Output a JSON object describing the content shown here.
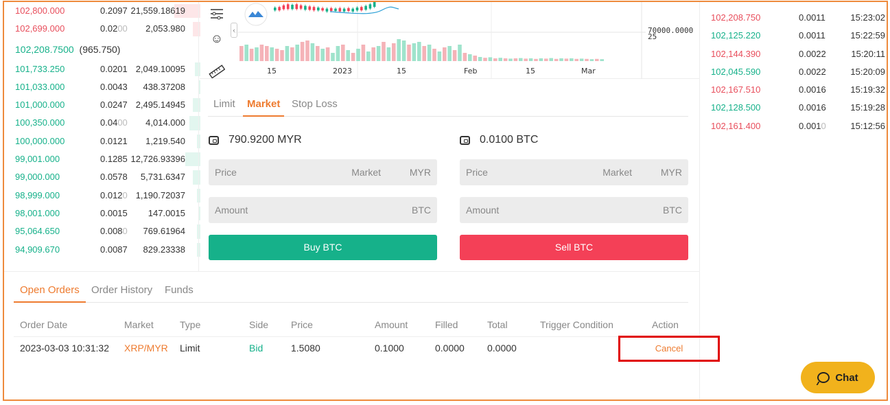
{
  "orderbook": {
    "asks": [
      {
        "price": "102,800.000",
        "qty": "0.2097",
        "total": "21,559.18619",
        "fill": 0.14
      },
      {
        "price": "102,699.000",
        "qty_main": "0.02",
        "qty_tail": "00",
        "total": "2,053.980",
        "fill": 0.04
      }
    ],
    "mid": {
      "price": "102,208.7500",
      "change": "(965.750)"
    },
    "bids": [
      {
        "price": "101,733.250",
        "qty": "0.0201",
        "total": "2,049.10095",
        "fill": 0.03
      },
      {
        "price": "101,033.000",
        "qty": "0.0043",
        "total": "438.37208",
        "fill": 0.01
      },
      {
        "price": "101,000.000",
        "qty": "0.0247",
        "total": "2,495.14945",
        "fill": 0.04
      },
      {
        "price": "100,350.000",
        "qty_main": "0.04",
        "qty_tail": "00",
        "total": "4,014.000",
        "fill": 0.06
      },
      {
        "price": "100,000.000",
        "qty": "0.0121",
        "total": "1,219.540",
        "fill": 0.02
      },
      {
        "price": "99,001.000",
        "qty": "0.1285",
        "total": "12,726.93396",
        "fill": 0.08
      },
      {
        "price": "99,000.000",
        "qty": "0.0578",
        "total": "5,731.6347",
        "fill": 0.04
      },
      {
        "price": "98,999.000",
        "qty_main": "0.012",
        "qty_tail": "0",
        "total": "1,190.72037",
        "fill": 0.02
      },
      {
        "price": "98,001.000",
        "qty": "0.0015",
        "total": "147.0015",
        "fill": 0.01
      },
      {
        "price": "95,064.650",
        "qty_main": "0.008",
        "qty_tail": "0",
        "total": "769.61964",
        "fill": 0.02
      },
      {
        "price": "94,909.670",
        "qty": "0.0087",
        "total": "829.23338",
        "fill": 0.02
      }
    ]
  },
  "chart": {
    "price_tag": "70000.0000",
    "price_tag_sub": "25",
    "x_labels": [
      "15",
      "2023",
      "15",
      "Feb",
      "15",
      "Mar"
    ],
    "volumes": [
      {
        "v": 0.55,
        "c": "r"
      },
      {
        "v": 0.6,
        "c": "g"
      },
      {
        "v": 0.45,
        "c": "r"
      },
      {
        "v": 0.5,
        "c": "g"
      },
      {
        "v": 0.6,
        "c": "r"
      },
      {
        "v": 0.55,
        "c": "r"
      },
      {
        "v": 0.5,
        "c": "g"
      },
      {
        "v": 0.45,
        "c": "r"
      },
      {
        "v": 0.4,
        "c": "r"
      },
      {
        "v": 0.55,
        "c": "g"
      },
      {
        "v": 0.5,
        "c": "r"
      },
      {
        "v": 0.6,
        "c": "g"
      },
      {
        "v": 0.7,
        "c": "r"
      },
      {
        "v": 0.75,
        "c": "r"
      },
      {
        "v": 0.65,
        "c": "g"
      },
      {
        "v": 0.55,
        "c": "r"
      },
      {
        "v": 0.45,
        "c": "g"
      },
      {
        "v": 0.5,
        "c": "r"
      },
      {
        "v": 0.3,
        "c": "g"
      },
      {
        "v": 0.55,
        "c": "g"
      },
      {
        "v": 0.6,
        "c": "r"
      },
      {
        "v": 0.4,
        "c": "g"
      },
      {
        "v": 0.3,
        "c": "r"
      },
      {
        "v": 0.45,
        "c": "g"
      },
      {
        "v": 0.6,
        "c": "r"
      },
      {
        "v": 0.35,
        "c": "g"
      },
      {
        "v": 0.5,
        "c": "r"
      },
      {
        "v": 0.55,
        "c": "g"
      },
      {
        "v": 0.7,
        "c": "r"
      },
      {
        "v": 0.5,
        "c": "g"
      },
      {
        "v": 0.65,
        "c": "r"
      },
      {
        "v": 0.8,
        "c": "g"
      },
      {
        "v": 0.75,
        "c": "g"
      },
      {
        "v": 0.6,
        "c": "r"
      },
      {
        "v": 0.65,
        "c": "g"
      },
      {
        "v": 0.7,
        "c": "g"
      },
      {
        "v": 0.55,
        "c": "r"
      },
      {
        "v": 0.6,
        "c": "g"
      },
      {
        "v": 0.45,
        "c": "r"
      },
      {
        "v": 0.35,
        "c": "g"
      },
      {
        "v": 0.5,
        "c": "r"
      },
      {
        "v": 0.55,
        "c": "g"
      },
      {
        "v": 0.4,
        "c": "r"
      },
      {
        "v": 0.6,
        "c": "g"
      },
      {
        "v": 0.3,
        "c": "r"
      },
      {
        "v": 0.25,
        "c": "g"
      },
      {
        "v": 0.2,
        "c": "r"
      },
      {
        "v": 0.15,
        "c": "g"
      },
      {
        "v": 0.12,
        "c": "r"
      },
      {
        "v": 0.14,
        "c": "g"
      },
      {
        "v": 0.1,
        "c": "r"
      },
      {
        "v": 0.12,
        "c": "g"
      },
      {
        "v": 0.1,
        "c": "r"
      },
      {
        "v": 0.09,
        "c": "g"
      },
      {
        "v": 0.1,
        "c": "r"
      },
      {
        "v": 0.11,
        "c": "g"
      },
      {
        "v": 0.09,
        "c": "r"
      },
      {
        "v": 0.1,
        "c": "g"
      },
      {
        "v": 0.08,
        "c": "r"
      },
      {
        "v": 0.1,
        "c": "g"
      },
      {
        "v": 0.09,
        "c": "r"
      },
      {
        "v": 0.11,
        "c": "g"
      },
      {
        "v": 0.08,
        "c": "r"
      },
      {
        "v": 0.1,
        "c": "g"
      },
      {
        "v": 0.09,
        "c": "r"
      },
      {
        "v": 0.1,
        "c": "g"
      },
      {
        "v": 0.08,
        "c": "r"
      },
      {
        "v": 0.09,
        "c": "g"
      },
      {
        "v": 0.08,
        "c": "r"
      },
      {
        "v": 0.07,
        "c": "g"
      },
      {
        "v": 0.08,
        "c": "r"
      },
      {
        "v": 0.07,
        "c": "g"
      }
    ],
    "candles": [
      {
        "y": 0.5,
        "h": 0.3,
        "c": "g"
      },
      {
        "y": 0.45,
        "h": 0.35,
        "c": "r"
      },
      {
        "y": 0.3,
        "h": 0.4,
        "c": "r"
      },
      {
        "y": 0.2,
        "h": 0.5,
        "c": "r"
      },
      {
        "y": 0.25,
        "h": 0.45,
        "c": "g"
      },
      {
        "y": 0.2,
        "h": 0.5,
        "c": "r"
      },
      {
        "y": 0.3,
        "h": 0.35,
        "c": "r"
      },
      {
        "y": 0.35,
        "h": 0.4,
        "c": "g"
      },
      {
        "y": 0.4,
        "h": 0.35,
        "c": "r"
      },
      {
        "y": 0.45,
        "h": 0.35,
        "c": "r"
      },
      {
        "y": 0.5,
        "h": 0.3,
        "c": "g"
      },
      {
        "y": 0.55,
        "h": 0.25,
        "c": "r"
      },
      {
        "y": 0.6,
        "h": 0.3,
        "c": "g"
      },
      {
        "y": 0.55,
        "h": 0.3,
        "c": "r"
      },
      {
        "y": 0.6,
        "h": 0.25,
        "c": "g"
      },
      {
        "y": 0.55,
        "h": 0.35,
        "c": "r"
      },
      {
        "y": 0.6,
        "h": 0.3,
        "c": "g"
      },
      {
        "y": 0.55,
        "h": 0.3,
        "c": "r"
      },
      {
        "y": 0.6,
        "h": 0.3,
        "c": "g"
      },
      {
        "y": 0.5,
        "h": 0.3,
        "c": "g"
      },
      {
        "y": 0.45,
        "h": 0.35,
        "c": "r"
      },
      {
        "y": 0.35,
        "h": 0.4,
        "c": "g"
      },
      {
        "y": 0.2,
        "h": 0.45,
        "c": "g"
      },
      {
        "y": 0.0,
        "h": 0.5,
        "c": "g"
      }
    ]
  },
  "trade": {
    "tabs": [
      "Limit",
      "Market",
      "Stop Loss"
    ],
    "active_tab": 1,
    "buy": {
      "balance": "790.9200 MYR",
      "price_label": "Price",
      "price_hint": "Market",
      "price_unit": "MYR",
      "amount_label": "Amount",
      "amount_unit": "BTC",
      "button": "Buy BTC"
    },
    "sell": {
      "balance": "0.0100 BTC",
      "price_label": "Price",
      "price_hint": "Market",
      "price_unit": "MYR",
      "amount_label": "Amount",
      "amount_unit": "BTC",
      "button": "Sell BTC"
    }
  },
  "orders": {
    "tabs": [
      "Open Orders",
      "Order History",
      "Funds"
    ],
    "headers": [
      "Order Date",
      "Market",
      "Type",
      "Side",
      "Price",
      "Amount",
      "Filled",
      "Total",
      "Trigger Condition",
      "Action"
    ],
    "row": {
      "date": "2023-03-03 10:31:32",
      "market": "XRP/MYR",
      "type": "Limit",
      "side": "Bid",
      "price": "1.5080",
      "amount": "0.1000",
      "filled": "0.0000",
      "total": "0.0000",
      "trigger": "",
      "action": "Cancel"
    }
  },
  "trades": [
    {
      "price": "102,208.750",
      "qty": "0.0011",
      "time": "15:23:02",
      "side": "sell"
    },
    {
      "price": "102,125.220",
      "qty": "0.0011",
      "time": "15:22:59",
      "side": "buy"
    },
    {
      "price": "102,144.390",
      "qty": "0.0022",
      "time": "15:20:11",
      "side": "sell"
    },
    {
      "price": "102,045.590",
      "qty": "0.0022",
      "time": "15:20:09",
      "side": "buy"
    },
    {
      "price": "102,167.510",
      "qty": "0.0016",
      "time": "15:19:32",
      "side": "sell"
    },
    {
      "price": "102,128.500",
      "qty": "0.0016",
      "time": "15:19:28",
      "side": "buy"
    },
    {
      "price": "102,161.400",
      "qty_main": "0.001",
      "qty_tail": "0",
      "time": "15:12:56",
      "side": "sell"
    }
  ],
  "chat": {
    "label": "Chat"
  },
  "colors": {
    "accent": "#ee7b2f",
    "buy": "#16b18a",
    "sell": "#f44057",
    "chat": "#f1b21c",
    "highlight": "#e00000"
  }
}
